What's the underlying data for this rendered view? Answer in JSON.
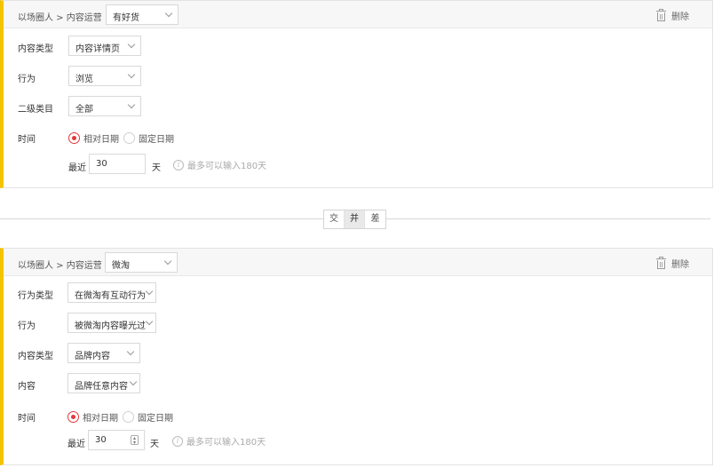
{
  "rule1": {
    "breadcrumb": "以场圈人 > 内容运营",
    "source": "有好货",
    "delete_label": "删除",
    "fields": [
      {
        "label": "内容类型",
        "value": "内容详情页"
      },
      {
        "label": "行为",
        "value": "浏览"
      },
      {
        "label": "二级类目",
        "value": "全部"
      }
    ],
    "time": {
      "label": "时间",
      "relative": "相对日期",
      "fixed": "固定日期",
      "selected": "relative",
      "recent_label": "最近",
      "days": "30",
      "unit": "天",
      "hint": "最多可以输入180天"
    }
  },
  "operators": {
    "items": [
      "交",
      "并",
      "差"
    ],
    "active": "并"
  },
  "rule2": {
    "breadcrumb": "以场圈人 > 内容运营",
    "source": "微淘",
    "delete_label": "删除",
    "fields": [
      {
        "label": "行为类型",
        "value": "在微淘有互动行为"
      },
      {
        "label": "行为",
        "value": "被微淘内容曝光过"
      },
      {
        "label": "内容类型",
        "value": "品牌内容"
      },
      {
        "label": "内容",
        "value": "品牌任意内容"
      }
    ],
    "time": {
      "label": "时间",
      "relative": "相对日期",
      "fixed": "固定日期",
      "selected": "relative",
      "recent_label": "最近",
      "days": "30",
      "unit": "天",
      "hint": "最多可以输入180天"
    }
  },
  "colors": {
    "accent_bar": "#f5c400",
    "radio_selected": "#e4393c"
  }
}
